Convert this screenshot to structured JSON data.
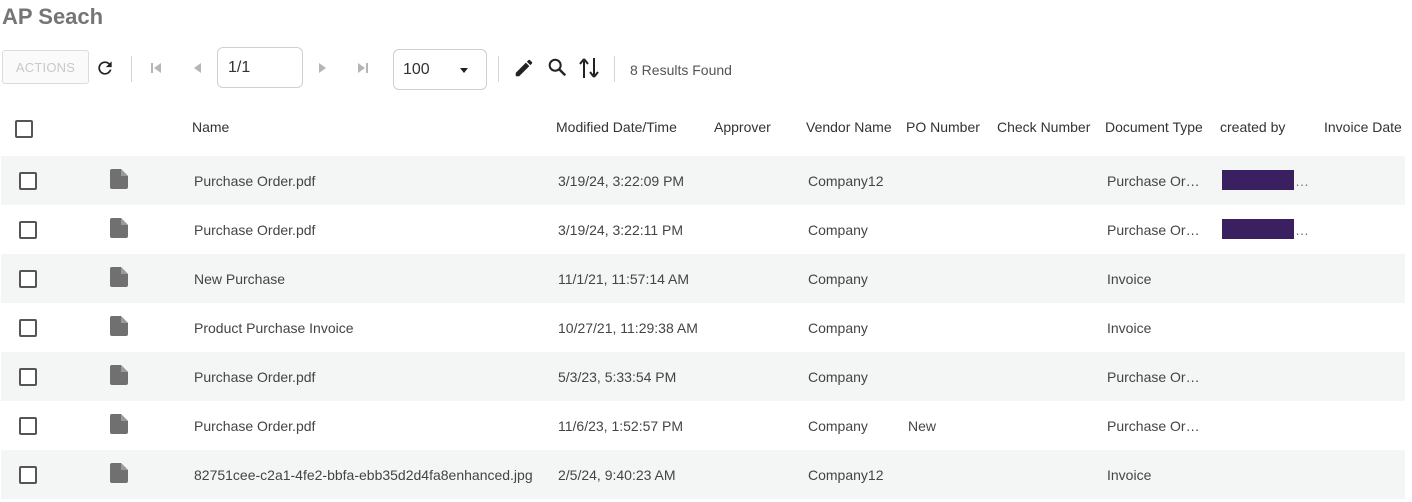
{
  "page": {
    "title": "AP Seach"
  },
  "toolbar": {
    "actions_label": "ACTIONS",
    "page_value": "1/1",
    "page_size": "100",
    "results_text": "8 Results Found"
  },
  "table": {
    "columns": {
      "name": "Name",
      "modified": "Modified Date/Time",
      "approver": "Approver",
      "vendor": "Vendor Name",
      "po": "PO Number",
      "check": "Check Number",
      "doctype": "Document Type",
      "createdby": "created by",
      "invoicedate": "Invoice Date"
    },
    "rows": [
      {
        "name": "Purchase Order.pdf",
        "modified": "3/19/24, 3:22:09 PM",
        "vendor": "Company12",
        "po": "",
        "doctype": "Purchase Or…",
        "createdby_redacted": true,
        "ellipsis": "…"
      },
      {
        "name": "Purchase Order.pdf",
        "modified": "3/19/24, 3:22:11 PM",
        "vendor": "Company",
        "po": "",
        "doctype": "Purchase Or…",
        "createdby_redacted": true,
        "ellipsis": "…"
      },
      {
        "name": "New Purchase",
        "modified": "11/1/21, 11:57:14 AM",
        "vendor": "Company",
        "po": "",
        "doctype": "Invoice",
        "createdby_redacted": false
      },
      {
        "name": "Product Purchase Invoice",
        "modified": "10/27/21, 11:29:38 AM",
        "vendor": "Company",
        "po": "",
        "doctype": "Invoice",
        "createdby_redacted": false
      },
      {
        "name": "Purchase Order.pdf",
        "modified": "5/3/23, 5:33:54 PM",
        "vendor": "Company",
        "po": "",
        "doctype": "Purchase Or…",
        "createdby_redacted": false
      },
      {
        "name": "Purchase Order.pdf",
        "modified": "11/6/23, 1:52:57 PM",
        "vendor": "Company",
        "po": "New",
        "doctype": "Purchase Or…",
        "createdby_redacted": false
      },
      {
        "name": "82751cee-c2a1-4fe2-bbfa-ebb35d2d4fa8enhanced.jpg",
        "modified": "2/5/24, 9:40:23 AM",
        "vendor": "Company12",
        "po": "",
        "doctype": "Invoice",
        "createdby_redacted": false
      }
    ]
  },
  "icons": {
    "refresh": "refresh-icon",
    "first": "first-page-icon",
    "prev": "previous-page-icon",
    "next": "next-page-icon",
    "last": "last-page-icon",
    "edit": "edit-pencil-icon",
    "search": "search-icon",
    "sort": "sort-icon",
    "file": "file-icon",
    "caret": "caret-down-icon"
  },
  "colors": {
    "title": "#757575",
    "alt_row": "#f4f5f5",
    "redaction": "#3a2060"
  }
}
